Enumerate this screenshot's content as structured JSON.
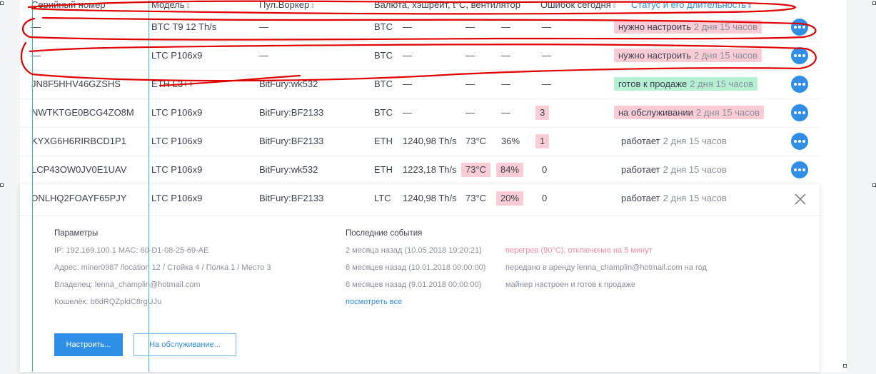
{
  "columns": {
    "serial": "Серийный номер",
    "model": "Модель",
    "pool": "Пул.Воркер",
    "currency": "Валюта, хэшрейт, t°C, вентилятор",
    "errors": "Ошибок сегодня",
    "status": "Статус и его длительность",
    "sort_icon": "⇕"
  },
  "rows": [
    {
      "serial": "—",
      "model": "BTC T9 12 Th/s",
      "pool": "—",
      "currency": "BTC",
      "hashrate": "—",
      "temp": "—",
      "fan": "—",
      "errors": "—",
      "status": "нужно настроить",
      "duration": "2 дня 15 часов",
      "status_color": "red"
    },
    {
      "serial": "—",
      "model": "LTC P106x9",
      "pool": "—",
      "currency": "BTC",
      "hashrate": "—",
      "temp": "—",
      "fan": "—",
      "errors": "—",
      "status": "нужно настроить",
      "duration": "2 дня 15 часов",
      "status_color": "red"
    },
    {
      "serial": "JN8F5HHV46GZSHS",
      "model": "ETH L3++",
      "pool": "BitFury:wk532",
      "currency": "BTC",
      "hashrate": "—",
      "temp": "—",
      "fan": "—",
      "errors": "—",
      "status": "готов к продаже",
      "duration": "2 дня 15 часов",
      "status_color": "green"
    },
    {
      "serial": "NWTKTGE0BCG4ZO8M",
      "model": "LTC P106x9",
      "pool": "BitFury:BF2133",
      "currency": "BTC",
      "hashrate": "—",
      "temp": "—",
      "fan": "—",
      "errors": "3",
      "status": "на обслуживании",
      "duration": "2 дня 15 часов",
      "status_color": "red"
    },
    {
      "serial": "KYXG6H6RIRBCD1P1",
      "model": "LTC P106x9",
      "pool": "BitFury:BF2133",
      "currency": "ETH",
      "hashrate": "1240,98 Th/s",
      "temp": "73°C",
      "fan": "36%",
      "errors": "1",
      "status": "работает",
      "duration": "2 дня 15 часов",
      "status_color": "none"
    },
    {
      "serial": "LCP43OW0JV0E1UAV",
      "model": "LTC P106x9",
      "pool": "BitFury:wk532",
      "currency": "ETH",
      "hashrate": "1223,18 Th/s",
      "temp": "73°C",
      "fan": "84%",
      "errors": "0",
      "status": "работает",
      "duration": "2 дня 15 часов",
      "status_color": "none"
    }
  ],
  "expanded": {
    "serial": "DNLHQ2FOAYF65PJY",
    "model": "LTC P106x9",
    "pool": "BitFury:BF2133",
    "currency": "LTC",
    "hashrate": "1240,98 Th/s",
    "temp": "73°C",
    "fan": "20%",
    "errors": "0",
    "status": "работает",
    "duration": "2 дня 15 часов",
    "params_title": "Параметры",
    "ip": "IP: 192.169.100.1    MAC: 60-D1-08-25-69-AE",
    "address": "Адрес: miner0987 /location 12 / Стойка  4 / Полка  1 / Место  3",
    "owner": "Владелец:  lenna_champlin@hotmail.com",
    "wallet": "Кошелёк:  b6dRQZpldC8rgUJu",
    "events_title": "Последние события",
    "events": [
      {
        "when": "2 месяца назад (10.05.2018 19:20:21)",
        "what": "перегрев (90°C), отключение на 5 минут",
        "alert": true
      },
      {
        "when": "6 месяцев назад (10.01.2018 00:00:00)",
        "what": "передано в аренду lenna_champlin@hotmail.com на год",
        "alert": false
      },
      {
        "when": "6 месяцев назад (9.01.2018 00:00:00)",
        "what": "майнер настроен и готов к продаже",
        "alert": false
      }
    ],
    "see_all": "посмотреть все",
    "btn_setup": "Настроить...",
    "btn_service": "На обслуживание..."
  },
  "colors": {
    "accent": "#2f8fe6",
    "alert_pill": "#f9ccd6",
    "ok_pill": "#b6f0d2",
    "guide": "#2ec4cc",
    "annotation": "#e00000"
  }
}
